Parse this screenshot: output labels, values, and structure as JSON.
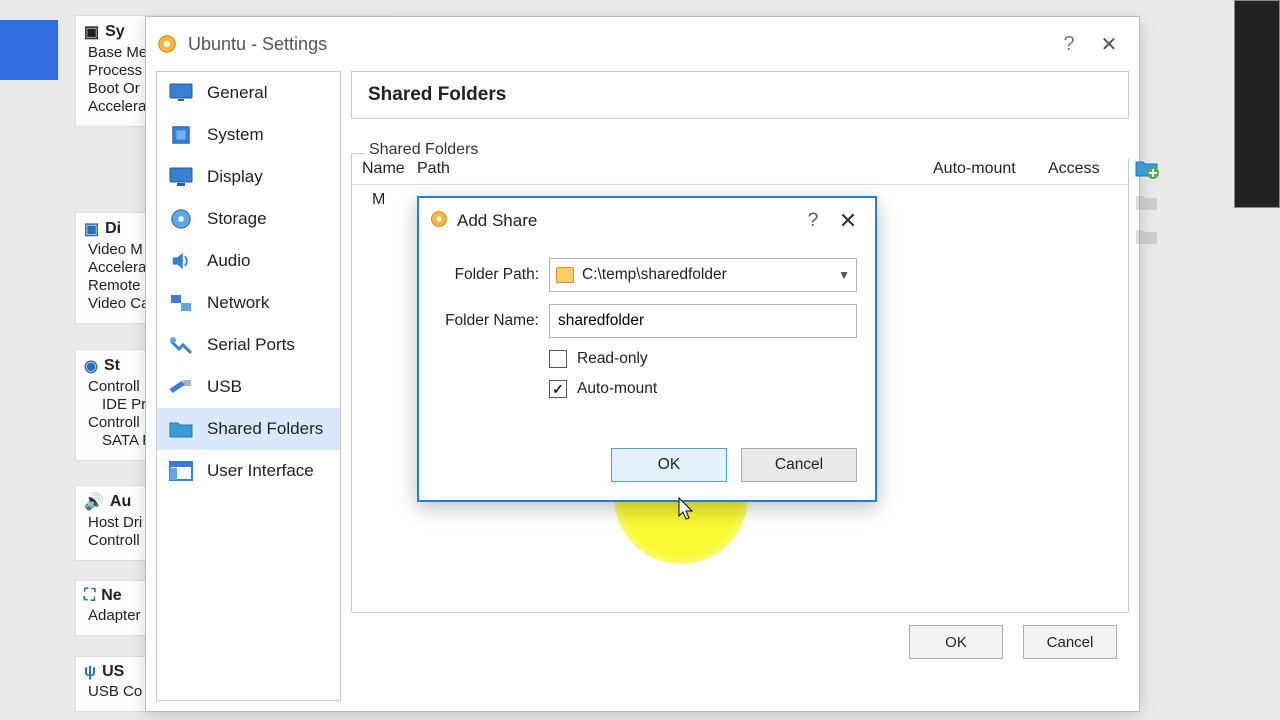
{
  "window": {
    "title": "Ubuntu - Settings",
    "help": "?",
    "close": "✕"
  },
  "sidebar": {
    "items": [
      {
        "label": "General"
      },
      {
        "label": "System"
      },
      {
        "label": "Display"
      },
      {
        "label": "Storage"
      },
      {
        "label": "Audio"
      },
      {
        "label": "Network"
      },
      {
        "label": "Serial Ports"
      },
      {
        "label": "USB"
      },
      {
        "label": "Shared Folders"
      },
      {
        "label": "User Interface"
      }
    ]
  },
  "main": {
    "heading": "Shared Folders",
    "group_label": "Shared Folders",
    "columns": {
      "name": "Name",
      "path": "Path",
      "auto": "Auto-mount",
      "access": "Access"
    },
    "row_prefix": "M"
  },
  "footer": {
    "ok": "OK",
    "cancel": "Cancel"
  },
  "dialog": {
    "title": "Add Share",
    "help": "?",
    "close": "✕",
    "labels": {
      "path": "Folder Path:",
      "name": "Folder Name:",
      "readonly": "Read-only",
      "automount": "Auto-mount"
    },
    "values": {
      "path": "C:\\temp\\sharedfolder",
      "name": "sharedfolder",
      "readonly": false,
      "automount": true
    },
    "buttons": {
      "ok": "OK",
      "cancel": "Cancel"
    }
  },
  "bg": {
    "system": {
      "h": "Sy",
      "lines": [
        "Base Me",
        "Process",
        "Boot Or",
        "Accelera"
      ]
    },
    "display": {
      "h": "Di",
      "lines": [
        "Video M",
        "Accelera",
        "Remote",
        "Video Ca"
      ]
    },
    "storage": {
      "h": "St",
      "lines": [
        "Controll",
        "IDE Pri",
        "Controll",
        "SATA P"
      ]
    },
    "audio": {
      "h": "Au",
      "lines": [
        "Host Dri",
        "Controll"
      ]
    },
    "network": {
      "h": "Ne",
      "lines": [
        "Adapter"
      ]
    },
    "usb": {
      "h": "US",
      "lines": [
        "USB Co"
      ]
    }
  }
}
